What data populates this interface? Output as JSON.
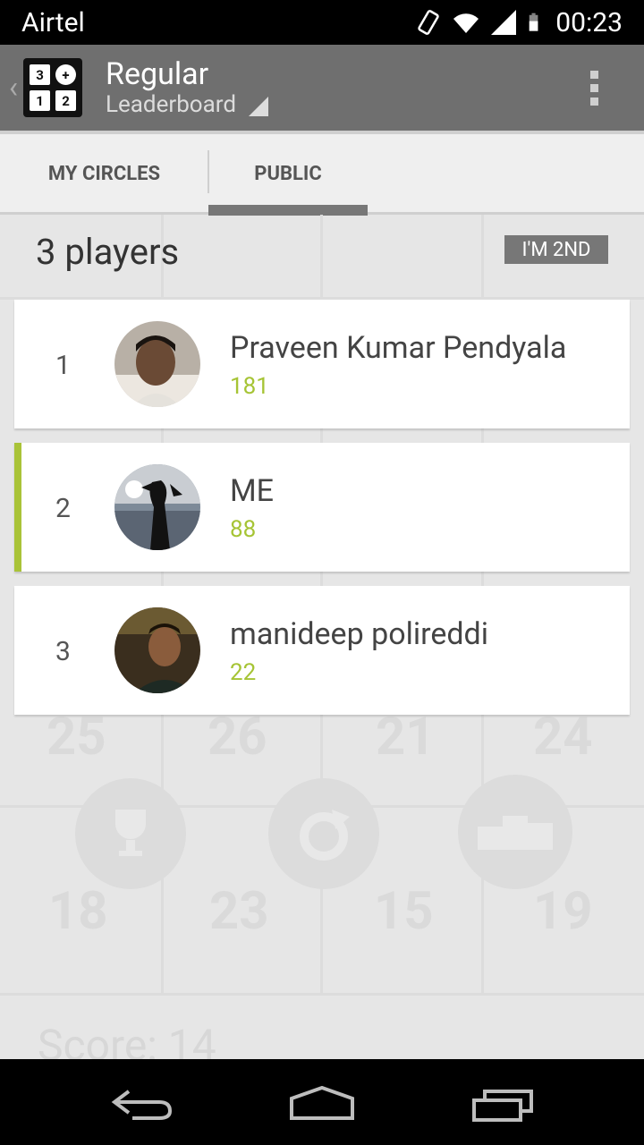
{
  "status_bar": {
    "carrier": "Airtel",
    "time": "00:23",
    "icons": [
      "vibrate-icon",
      "wifi-icon",
      "signal-icon",
      "battery-icon"
    ]
  },
  "action_bar": {
    "title": "Regular",
    "subtitle": "Leaderboard",
    "app_icon_digits": [
      "3",
      "+",
      "1",
      "2"
    ]
  },
  "tabs": [
    {
      "label": "MY CIRCLES",
      "selected": false
    },
    {
      "label": "PUBLIC",
      "selected": true
    }
  ],
  "leaderboard": {
    "players_count": "3 players",
    "my_rank_badge": "I'M 2ND",
    "rows": [
      {
        "rank": "1",
        "name": "Praveen Kumar Pendyala",
        "score": "181"
      },
      {
        "rank": "2",
        "name": "ME",
        "score": "88"
      },
      {
        "rank": "3",
        "name": "manideep polireddi",
        "score": "22"
      }
    ]
  },
  "background_game": {
    "numbers": [
      "25",
      "26",
      "21",
      "24",
      "18",
      "23",
      "15",
      "19"
    ],
    "score_label": "Score: 14"
  },
  "colors": {
    "accent": "#a6c435",
    "action_bar": "#6f6f6f",
    "tab_indicator": "#777777"
  }
}
